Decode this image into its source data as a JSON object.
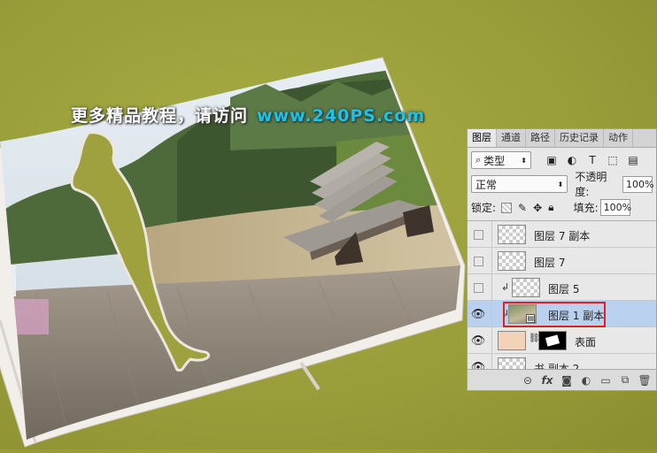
{
  "watermark": {
    "text": "更多精品教程，请访问",
    "url": "www.240PS.com"
  },
  "panel": {
    "tabs": [
      "图层",
      "通道",
      "路径",
      "历史记录",
      "动作"
    ],
    "filter": {
      "icon": "search-icon",
      "label": "类型"
    },
    "blend_mode": "正常",
    "opacity_label": "不透明度:",
    "opacity_value": "100%",
    "lock_label": "锁定:",
    "fill_label": "填充:",
    "fill_value": "100%",
    "layers": [
      {
        "name": "图层 7 副本",
        "visible": false,
        "clipped": false,
        "selected": false
      },
      {
        "name": "图层 7",
        "visible": false,
        "clipped": false,
        "selected": false
      },
      {
        "name": "图层 5",
        "visible": false,
        "clipped": true,
        "selected": false
      },
      {
        "name": "图层 1 副本",
        "visible": true,
        "clipped": true,
        "selected": true
      },
      {
        "name": "表面",
        "visible": true,
        "clipped": false,
        "selected": false,
        "has_mask": true
      },
      {
        "name": "书 副本 2",
        "visible": true,
        "clipped": false,
        "selected": false
      }
    ]
  },
  "colors": {
    "background": "#9ea13e",
    "selected_layer": "#b9d1ef",
    "highlight_box": "#e0201e",
    "url": "#19c4e8"
  }
}
